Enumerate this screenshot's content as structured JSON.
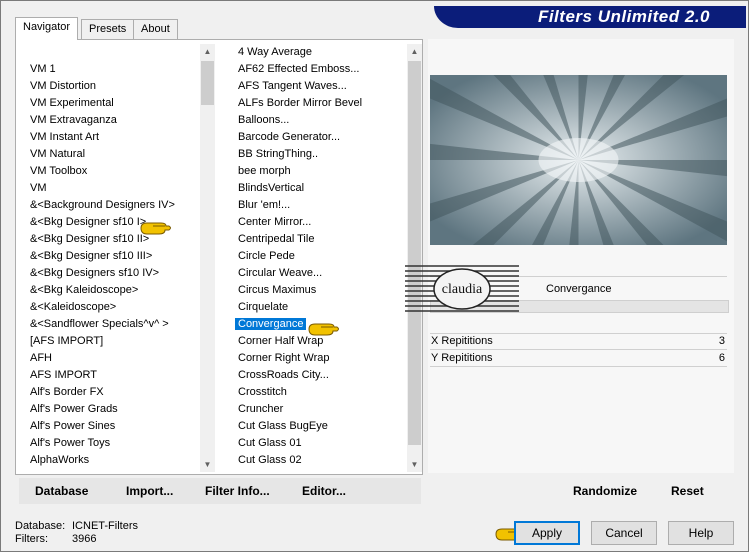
{
  "window": {
    "title": "Filters Unlimited 2.0"
  },
  "tabs": [
    {
      "label": "Navigator",
      "active": true
    },
    {
      "label": "Presets",
      "active": false
    },
    {
      "label": "About",
      "active": false
    }
  ],
  "categories": [
    "VM 1",
    "VM Distortion",
    "VM Experimental",
    "VM Extravaganza",
    "VM Instant Art",
    "VM Natural",
    "VM Toolbox",
    "VM",
    "&<Background Designers IV>",
    "&<Bkg Designer sf10 I>",
    "&<Bkg Designer sf10 II>",
    "&<Bkg Designer sf10 III>",
    "&<Bkg Designers sf10 IV>",
    "&<Bkg Kaleidoscope>",
    "&<Kaleidoscope>",
    "&<Sandflower Specials^v^ >",
    "[AFS IMPORT]",
    "AFH",
    "AFS IMPORT",
    "Alf's Border FX",
    "Alf's Power Grads",
    "Alf's Power Sines",
    "Alf's Power Toys",
    "AlphaWorks"
  ],
  "filters": [
    "4 Way Average",
    "AF62 Effected Emboss...",
    "AFS Tangent Waves...",
    "ALFs Border Mirror Bevel",
    "Balloons...",
    "Barcode Generator...",
    "BB StringThing..",
    "bee morph",
    "BlindsVertical",
    "Blur 'em!...",
    "Center Mirror...",
    "Centripedal Tile",
    "Circle Pede",
    "Circular Weave...",
    "Circus Maximus",
    "Cirquelate",
    "Convergance",
    "Corner Half Wrap",
    "Corner Right Wrap",
    "CrossRoads City...",
    "Crosstitch",
    "Cruncher",
    "Cut Glass  BugEye",
    "Cut Glass 01",
    "Cut Glass 02"
  ],
  "selected_filter_index": 16,
  "buttons": {
    "database": "Database",
    "import": "Import...",
    "filter_info": "Filter Info...",
    "editor": "Editor...",
    "randomize": "Randomize",
    "reset": "Reset",
    "apply": "Apply",
    "cancel": "Cancel",
    "help": "Help"
  },
  "preview": {
    "filter_name": "Convergance",
    "logo_text": "claudia"
  },
  "params": [
    {
      "label": "X Repititions",
      "value": "3"
    },
    {
      "label": "Y Repititions",
      "value": "6"
    }
  ],
  "status": {
    "database_label": "Database:",
    "database_value": "ICNET-Filters",
    "filters_label": "Filters:",
    "filters_value": "3966"
  },
  "colors": {
    "title_bar": "#0b1d7a",
    "selection": "#0078d7",
    "hand_pointer": "#f2c200"
  }
}
